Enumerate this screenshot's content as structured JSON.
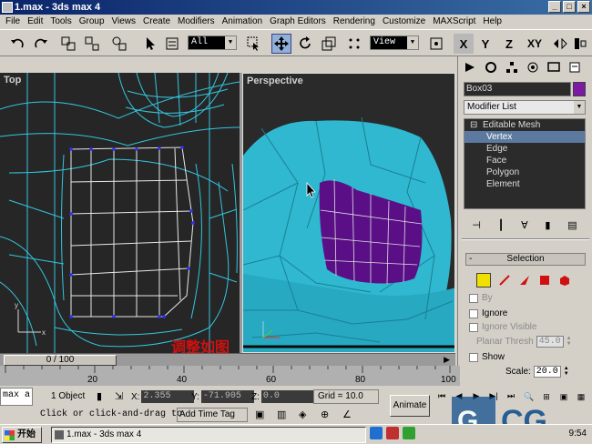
{
  "window": {
    "title": "1.max - 3ds max 4"
  },
  "menu": [
    "File",
    "Edit",
    "Tools",
    "Group",
    "Views",
    "Create",
    "Modifiers",
    "Animation",
    "Graph Editors",
    "Rendering",
    "Customize",
    "MAXScript",
    "Help"
  ],
  "toolbar": {
    "selection_filter": "All",
    "ref_coord": "View",
    "axis": [
      "X",
      "Y",
      "Z",
      "XY"
    ]
  },
  "viewports": {
    "top_label": "Top",
    "persp_label": "Perspective",
    "caption": "调整如图"
  },
  "command_panel": {
    "object_name": "Box03",
    "object_color": "#7c1aa6",
    "modifier_list": "Modifier List",
    "stack": [
      {
        "label": "Editable Mesh",
        "level": 0
      },
      {
        "label": "Vertex",
        "level": 1
      },
      {
        "label": "Edge",
        "level": 1
      },
      {
        "label": "Face",
        "level": 1
      },
      {
        "label": "Polygon",
        "level": 1
      },
      {
        "label": "Element",
        "level": 1
      }
    ],
    "selection_rollout": {
      "title": "Selection",
      "by": "By",
      "ignore": "Ignore",
      "ignore_visible": "Ignore Visible",
      "planar_label": "Planar Thresh",
      "planar_value": "45.0",
      "show": "Show",
      "scale_label": "Scale:",
      "scale_value": "20.0"
    }
  },
  "timeline": {
    "slider": "0 / 100",
    "ticks": [
      "20",
      "40",
      "60",
      "80",
      "100"
    ]
  },
  "status": {
    "maxscript": "max a",
    "selection": "1 Object",
    "x_label": "X:",
    "x_value": "2.355",
    "y_label": "Y:",
    "y_value": "-71.905",
    "z_label": "Z:",
    "z_value": "0.0",
    "grid": "Grid = 10.0",
    "animate": "Animate",
    "prompt": "Click or click-and-drag to",
    "add_time_tag": "Add Time Tag"
  },
  "taskbar": {
    "start": "开始",
    "task": "1.max - 3ds max 4",
    "clock": "9:54"
  },
  "colors": {
    "mesh": "#2fb8d0",
    "selected_faces": "#5a0f86",
    "wire": "#33c6e0"
  }
}
